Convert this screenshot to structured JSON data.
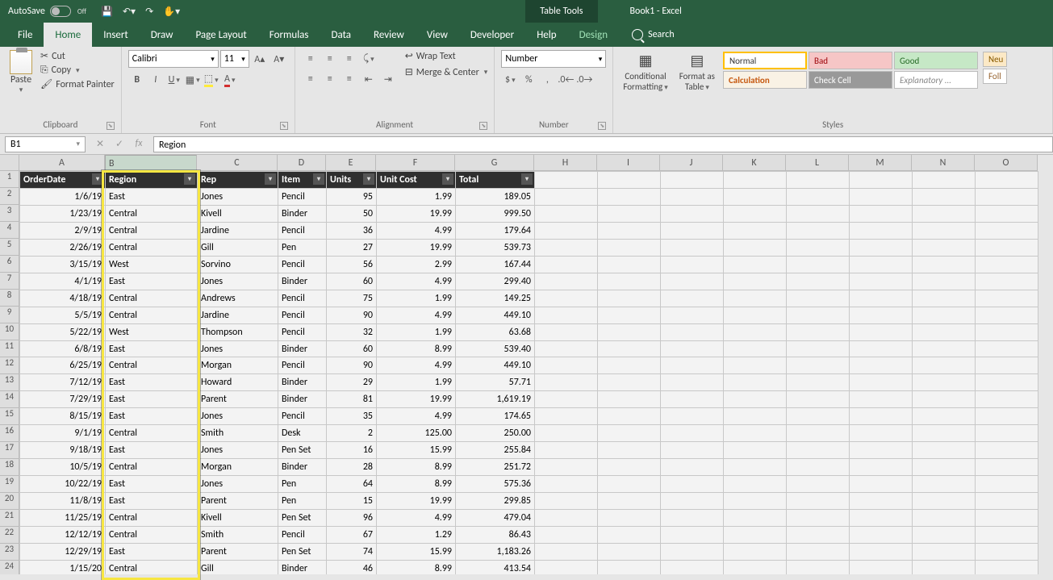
{
  "titlebar": {
    "autosave_label": "AutoSave",
    "autosave_state": "Off",
    "contextual": "Table Tools",
    "book": "Book1  -  Excel"
  },
  "tabs": {
    "file": "File",
    "home": "Home",
    "insert": "Insert",
    "draw": "Draw",
    "page_layout": "Page Layout",
    "formulas": "Formulas",
    "data": "Data",
    "review": "Review",
    "view": "View",
    "developer": "Developer",
    "help": "Help",
    "design": "Design",
    "search": "Search"
  },
  "ribbon": {
    "paste": "Paste",
    "cut": "Cut",
    "copy": "Copy",
    "format_painter": "Format Painter",
    "clipboard": "Clipboard",
    "font_name": "Calibri",
    "font_size": "11",
    "font": "Font",
    "alignment": "Alignment",
    "wrap": "Wrap Text",
    "merge": "Merge & Center",
    "number_format": "Number",
    "number": "Number",
    "cond": "Conditional",
    "cond2": "Formatting",
    "fmt_table": "Format as",
    "fmt_table2": "Table",
    "style_normal": "Normal",
    "style_bad": "Bad",
    "style_good": "Good",
    "style_neutral": "Neu",
    "style_calc": "Calculation",
    "style_check": "Check Cell",
    "style_explan": "Explanatory ...",
    "style_foll": "Foll",
    "styles": "Styles"
  },
  "formula_bar": {
    "cell": "B1",
    "value": "Region"
  },
  "columns": [
    "A",
    "B",
    "C",
    "D",
    "E",
    "F",
    "G",
    "H",
    "I",
    "J",
    "K",
    "L",
    "M",
    "N",
    "O"
  ],
  "headers": [
    "OrderDate",
    "Region",
    "Rep",
    "Item",
    "Units",
    "Unit Cost",
    "Total"
  ],
  "rows": [
    {
      "n": 2,
      "date": "1/6/19",
      "region": "East",
      "rep": "Jones",
      "item": "Pencil",
      "units": "95",
      "cost": "1.99",
      "total": "189.05"
    },
    {
      "n": 3,
      "date": "1/23/19",
      "region": "Central",
      "rep": "Kivell",
      "item": "Binder",
      "units": "50",
      "cost": "19.99",
      "total": "999.50"
    },
    {
      "n": 4,
      "date": "2/9/19",
      "region": "Central",
      "rep": "Jardine",
      "item": "Pencil",
      "units": "36",
      "cost": "4.99",
      "total": "179.64"
    },
    {
      "n": 5,
      "date": "2/26/19",
      "region": "Central",
      "rep": "Gill",
      "item": "Pen",
      "units": "27",
      "cost": "19.99",
      "total": "539.73"
    },
    {
      "n": 6,
      "date": "3/15/19",
      "region": "West",
      "rep": "Sorvino",
      "item": "Pencil",
      "units": "56",
      "cost": "2.99",
      "total": "167.44"
    },
    {
      "n": 7,
      "date": "4/1/19",
      "region": "East",
      "rep": "Jones",
      "item": "Binder",
      "units": "60",
      "cost": "4.99",
      "total": "299.40"
    },
    {
      "n": 8,
      "date": "4/18/19",
      "region": "Central",
      "rep": "Andrews",
      "item": "Pencil",
      "units": "75",
      "cost": "1.99",
      "total": "149.25"
    },
    {
      "n": 9,
      "date": "5/5/19",
      "region": "Central",
      "rep": "Jardine",
      "item": "Pencil",
      "units": "90",
      "cost": "4.99",
      "total": "449.10"
    },
    {
      "n": 10,
      "date": "5/22/19",
      "region": "West",
      "rep": "Thompson",
      "item": "Pencil",
      "units": "32",
      "cost": "1.99",
      "total": "63.68"
    },
    {
      "n": 11,
      "date": "6/8/19",
      "region": "East",
      "rep": "Jones",
      "item": "Binder",
      "units": "60",
      "cost": "8.99",
      "total": "539.40"
    },
    {
      "n": 12,
      "date": "6/25/19",
      "region": "Central",
      "rep": "Morgan",
      "item": "Pencil",
      "units": "90",
      "cost": "4.99",
      "total": "449.10"
    },
    {
      "n": 13,
      "date": "7/12/19",
      "region": "East",
      "rep": "Howard",
      "item": "Binder",
      "units": "29",
      "cost": "1.99",
      "total": "57.71"
    },
    {
      "n": 14,
      "date": "7/29/19",
      "region": "East",
      "rep": "Parent",
      "item": "Binder",
      "units": "81",
      "cost": "19.99",
      "total": "1,619.19"
    },
    {
      "n": 15,
      "date": "8/15/19",
      "region": "East",
      "rep": "Jones",
      "item": "Pencil",
      "units": "35",
      "cost": "4.99",
      "total": "174.65"
    },
    {
      "n": 16,
      "date": "9/1/19",
      "region": "Central",
      "rep": "Smith",
      "item": "Desk",
      "units": "2",
      "cost": "125.00",
      "total": "250.00"
    },
    {
      "n": 17,
      "date": "9/18/19",
      "region": "East",
      "rep": "Jones",
      "item": "Pen Set",
      "units": "16",
      "cost": "15.99",
      "total": "255.84"
    },
    {
      "n": 18,
      "date": "10/5/19",
      "region": "Central",
      "rep": "Morgan",
      "item": "Binder",
      "units": "28",
      "cost": "8.99",
      "total": "251.72"
    },
    {
      "n": 19,
      "date": "10/22/19",
      "region": "East",
      "rep": "Jones",
      "item": "Pen",
      "units": "64",
      "cost": "8.99",
      "total": "575.36"
    },
    {
      "n": 20,
      "date": "11/8/19",
      "region": "East",
      "rep": "Parent",
      "item": "Pen",
      "units": "15",
      "cost": "19.99",
      "total": "299.85"
    },
    {
      "n": 21,
      "date": "11/25/19",
      "region": "Central",
      "rep": "Kivell",
      "item": "Pen Set",
      "units": "96",
      "cost": "4.99",
      "total": "479.04"
    },
    {
      "n": 22,
      "date": "12/12/19",
      "region": "Central",
      "rep": "Smith",
      "item": "Pencil",
      "units": "67",
      "cost": "1.29",
      "total": "86.43"
    },
    {
      "n": 23,
      "date": "12/29/19",
      "region": "East",
      "rep": "Parent",
      "item": "Pen Set",
      "units": "74",
      "cost": "15.99",
      "total": "1,183.26"
    },
    {
      "n": 24,
      "date": "1/15/20",
      "region": "Central",
      "rep": "Gill",
      "item": "Binder",
      "units": "46",
      "cost": "8.99",
      "total": "413.54"
    }
  ]
}
